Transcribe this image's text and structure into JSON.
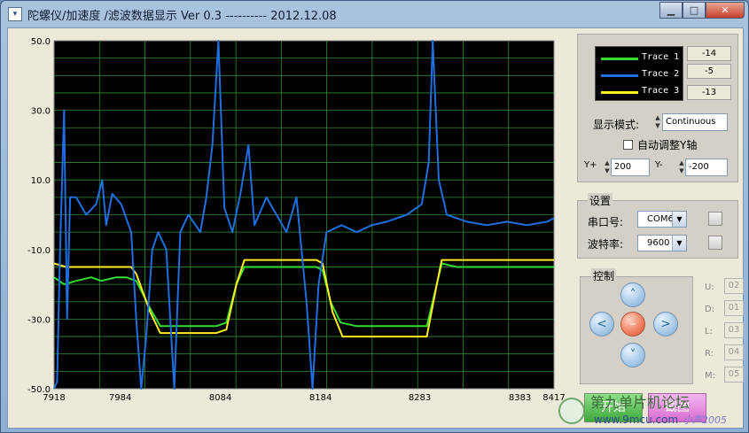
{
  "window": {
    "title": "陀螺仪/加速度 /滤波数据显示 Ver 0.3    ----------   2012.12.08"
  },
  "chart_data": {
    "type": "line",
    "xlim": [
      7918,
      8417
    ],
    "ylim": [
      -50,
      50
    ],
    "x_ticks": [
      "7918",
      "7984",
      "8084",
      "8184",
      "8283",
      "8383",
      "8417"
    ],
    "y_ticks": [
      "50.0",
      "30.0",
      "10.0",
      "-10.0",
      "-30.0",
      "-50.0"
    ],
    "grid": true,
    "series": [
      {
        "name": "Trace 1",
        "color": "#33dd33",
        "points": [
          [
            7918,
            -18
          ],
          [
            7928,
            -20
          ],
          [
            7940,
            -19
          ],
          [
            7955,
            -18
          ],
          [
            7965,
            -19
          ],
          [
            7980,
            -18
          ],
          [
            7990,
            -18
          ],
          [
            8000,
            -19
          ],
          [
            8014,
            -27
          ],
          [
            8024,
            -32
          ],
          [
            8038,
            -32
          ],
          [
            8060,
            -32
          ],
          [
            8080,
            -32
          ],
          [
            8090,
            -31
          ],
          [
            8100,
            -20
          ],
          [
            8108,
            -15
          ],
          [
            8120,
            -15
          ],
          [
            8140,
            -15
          ],
          [
            8160,
            -15
          ],
          [
            8180,
            -15
          ],
          [
            8186,
            -16
          ],
          [
            8194,
            -25
          ],
          [
            8204,
            -31
          ],
          [
            8220,
            -32
          ],
          [
            8240,
            -32
          ],
          [
            8260,
            -32
          ],
          [
            8290,
            -32
          ],
          [
            8300,
            -20
          ],
          [
            8305,
            -14
          ],
          [
            8320,
            -15
          ],
          [
            8350,
            -15
          ],
          [
            8380,
            -15
          ],
          [
            8417,
            -15
          ]
        ]
      },
      {
        "name": "Trace 2",
        "color": "#1f6fdf",
        "points": [
          [
            7918,
            -50
          ],
          [
            7921,
            -48
          ],
          [
            7924,
            -10
          ],
          [
            7928,
            30
          ],
          [
            7931,
            -30
          ],
          [
            7934,
            5
          ],
          [
            7940,
            5
          ],
          [
            7950,
            0
          ],
          [
            7960,
            3
          ],
          [
            7966,
            10
          ],
          [
            7970,
            -3
          ],
          [
            7976,
            6
          ],
          [
            7985,
            3
          ],
          [
            7995,
            -5
          ],
          [
            8000,
            -30
          ],
          [
            8005,
            -50
          ],
          [
            8010,
            -35
          ],
          [
            8016,
            -10
          ],
          [
            8022,
            -5
          ],
          [
            8030,
            -10
          ],
          [
            8038,
            -50
          ],
          [
            8044,
            -5
          ],
          [
            8052,
            0
          ],
          [
            8064,
            -5
          ],
          [
            8070,
            5
          ],
          [
            8076,
            20
          ],
          [
            8082,
            50
          ],
          [
            8088,
            2
          ],
          [
            8096,
            -5
          ],
          [
            8104,
            6
          ],
          [
            8112,
            20
          ],
          [
            8118,
            -3
          ],
          [
            8130,
            5
          ],
          [
            8140,
            0
          ],
          [
            8150,
            -5
          ],
          [
            8160,
            5
          ],
          [
            8170,
            -25
          ],
          [
            8176,
            -50
          ],
          [
            8182,
            -20
          ],
          [
            8190,
            -5
          ],
          [
            8205,
            -3
          ],
          [
            8220,
            -5
          ],
          [
            8235,
            -3
          ],
          [
            8250,
            -2
          ],
          [
            8270,
            0
          ],
          [
            8285,
            3
          ],
          [
            8292,
            15
          ],
          [
            8296,
            50
          ],
          [
            8302,
            10
          ],
          [
            8310,
            0
          ],
          [
            8330,
            -2
          ],
          [
            8350,
            -3
          ],
          [
            8370,
            -2
          ],
          [
            8390,
            -3
          ],
          [
            8410,
            -2
          ],
          [
            8417,
            -1
          ]
        ]
      },
      {
        "name": "Trace 3",
        "color": "#ffee22",
        "points": [
          [
            7918,
            -14
          ],
          [
            7930,
            -15
          ],
          [
            7945,
            -15
          ],
          [
            7960,
            -15
          ],
          [
            7980,
            -15
          ],
          [
            7995,
            -15
          ],
          [
            8000,
            -17
          ],
          [
            8014,
            -28
          ],
          [
            8024,
            -34
          ],
          [
            8040,
            -34
          ],
          [
            8060,
            -34
          ],
          [
            8080,
            -34
          ],
          [
            8090,
            -33
          ],
          [
            8100,
            -20
          ],
          [
            8108,
            -13
          ],
          [
            8120,
            -13
          ],
          [
            8140,
            -13
          ],
          [
            8160,
            -13
          ],
          [
            8180,
            -13
          ],
          [
            8186,
            -14
          ],
          [
            8196,
            -28
          ],
          [
            8206,
            -35
          ],
          [
            8220,
            -35
          ],
          [
            8240,
            -35
          ],
          [
            8260,
            -35
          ],
          [
            8290,
            -35
          ],
          [
            8300,
            -20
          ],
          [
            8305,
            -13
          ],
          [
            8320,
            -13
          ],
          [
            8350,
            -13
          ],
          [
            8380,
            -13
          ],
          [
            8417,
            -13
          ]
        ]
      }
    ]
  },
  "legend": {
    "items": [
      {
        "label": "Trace 1",
        "color": "#33dd33",
        "value": "-14"
      },
      {
        "label": "Trace 2",
        "color": "#1f6fdf",
        "value": "-5"
      },
      {
        "label": "Trace 3",
        "color": "#ffee22",
        "value": "-13"
      }
    ]
  },
  "controls": {
    "display_mode_label": "显示模式:",
    "display_mode_value": "Continuous",
    "auto_adjust_label": "自动调整Y轴",
    "auto_adjust_checked": false,
    "y_plus_label": "Y+",
    "y_plus_value": "200",
    "y_minus_label": "Y-",
    "y_minus_value": "-200"
  },
  "settings": {
    "group_title": "设置",
    "port_label": "串口号:",
    "port_value": "COM6",
    "baud_label": "波特率:",
    "baud_value": "9600"
  },
  "control_pad": {
    "group_title": "控制",
    "up": "˄",
    "down": "˅",
    "left": "<",
    "right": ">",
    "center": "–"
  },
  "servos": [
    {
      "label": "U:",
      "value": "02"
    },
    {
      "label": "D:",
      "value": "01"
    },
    {
      "label": "L:",
      "value": "03"
    },
    {
      "label": "R:",
      "value": "04"
    },
    {
      "label": "M:",
      "value": "05"
    }
  ],
  "buttons": {
    "open": "开始",
    "save": "截图"
  },
  "watermark": {
    "main": "第九单片机论坛",
    "url": "www.9mcu.com",
    "tag": "小声2005"
  }
}
